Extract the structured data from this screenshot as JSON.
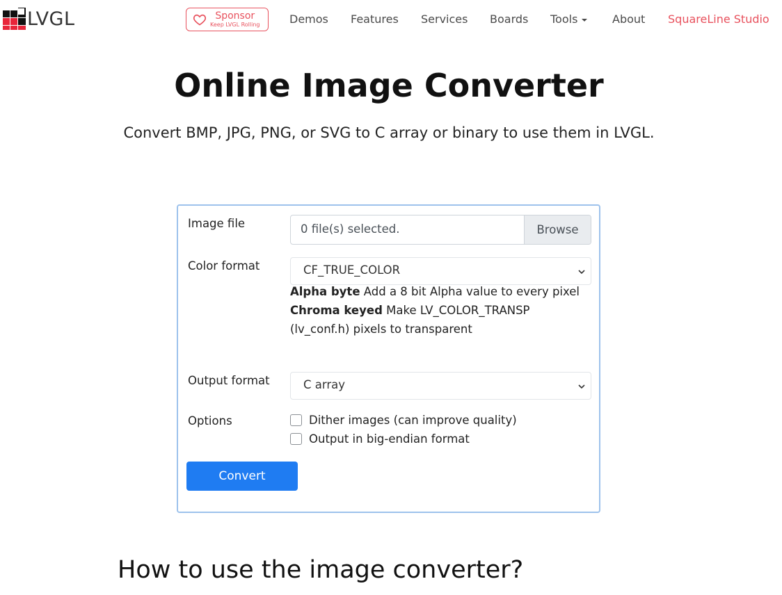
{
  "logo": {
    "text": "LVGL"
  },
  "sponsor": {
    "label": "Sponsor",
    "tagline": "Keep LVGL Rolling"
  },
  "nav": {
    "items": [
      {
        "label": "Demos"
      },
      {
        "label": "Features"
      },
      {
        "label": "Services"
      },
      {
        "label": "Boards"
      },
      {
        "label": "Tools"
      },
      {
        "label": "About"
      },
      {
        "label": "SquareLine Studio"
      }
    ]
  },
  "hero": {
    "title": "Online Image Converter",
    "subtitle": "Convert BMP, JPG, PNG, or SVG to C array or binary to use them in LVGL."
  },
  "form": {
    "image_file_label": "Image file",
    "file_status": "0 file(s) selected.",
    "browse_label": "Browse",
    "color_format_label": "Color format",
    "color_format_value": "CF_TRUE_COLOR",
    "help_alpha_title": "Alpha byte",
    "help_alpha_text": " Add a 8 bit Alpha value to every pixel",
    "help_chroma_title": "Chroma keyed",
    "help_chroma_text": " Make LV_COLOR_TRANSP (lv_conf.h) pixels to transparent",
    "output_format_label": "Output format",
    "output_format_value": "C array",
    "options_label": "Options",
    "option_dither": "Dither images (can improve quality)",
    "option_big_endian": "Output in big-endian format",
    "convert_label": "Convert"
  },
  "how_to": {
    "heading": "How to use the image converter?"
  },
  "colors": {
    "accent": "#e8515d",
    "primary": "#1f7cf2",
    "card_border": "#9dc2ec"
  }
}
